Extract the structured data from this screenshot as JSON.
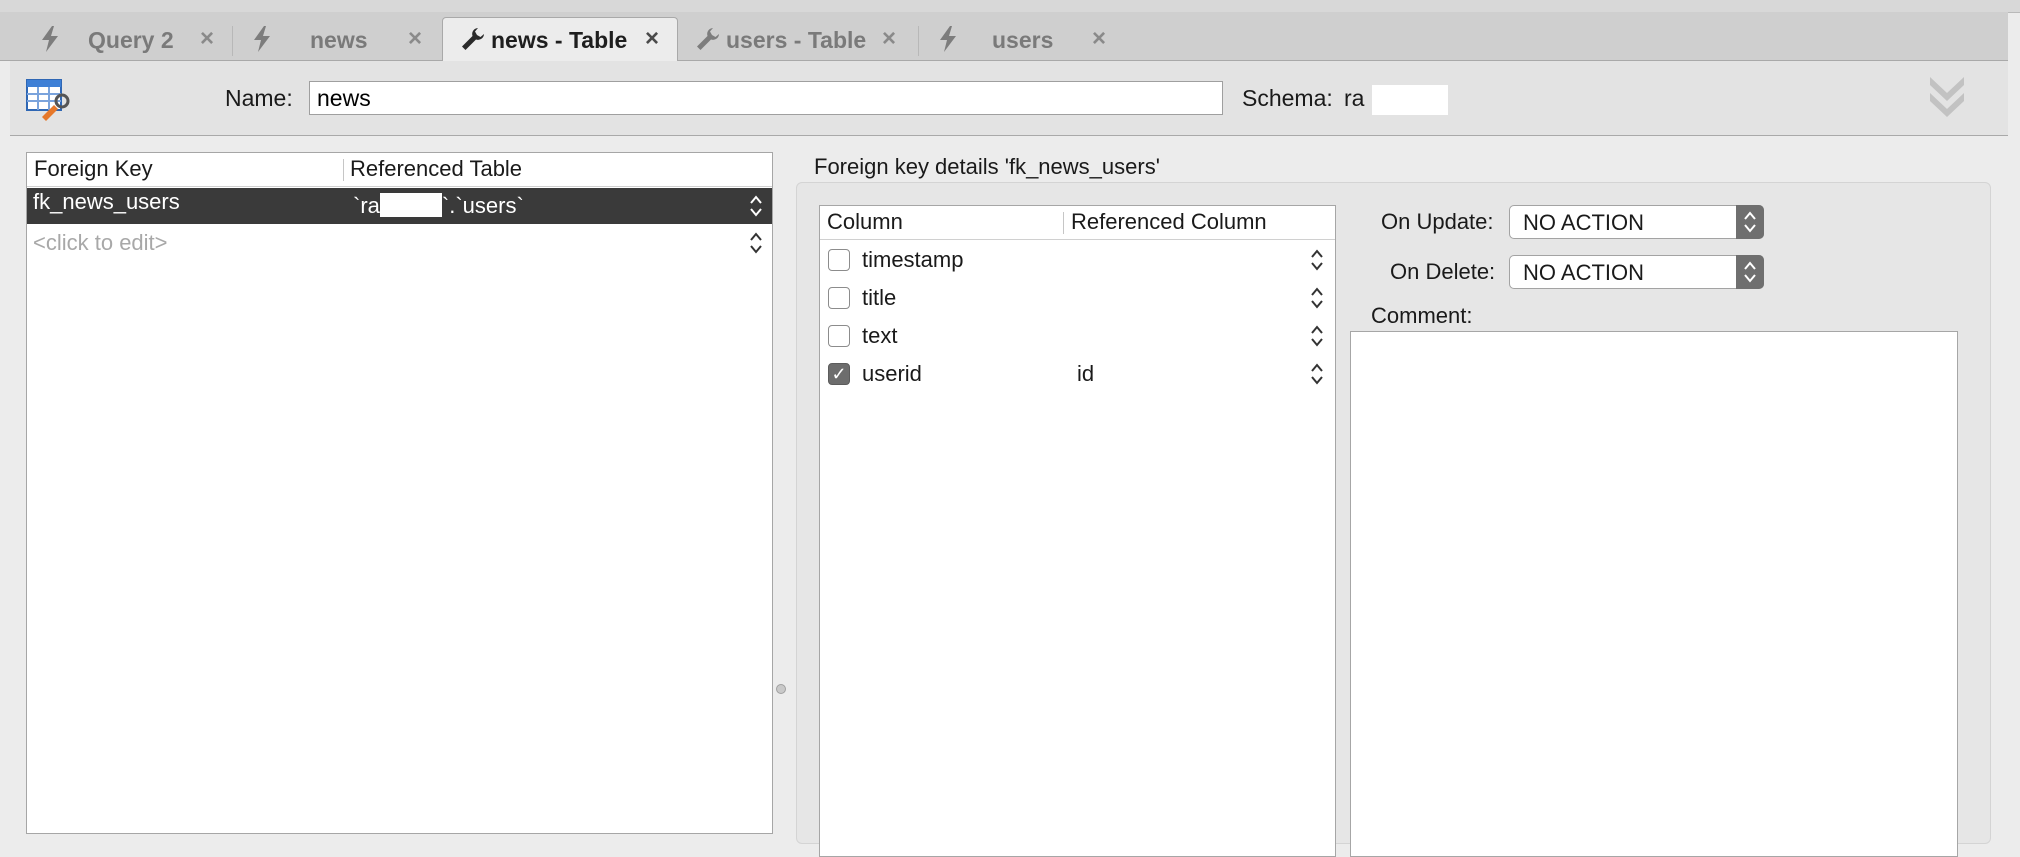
{
  "tabs": [
    {
      "label": "Query 2",
      "icon": "lightning-icon",
      "active": false
    },
    {
      "label": "news",
      "icon": "lightning-icon",
      "active": false
    },
    {
      "label": "news - Table",
      "icon": "wrench-icon",
      "active": true
    },
    {
      "label": "users - Table",
      "icon": "wrench-icon",
      "active": false
    },
    {
      "label": "users",
      "icon": "lightning-icon",
      "active": false
    }
  ],
  "header": {
    "name_label": "Name:",
    "name_value": "news",
    "schema_label": "Schema:",
    "schema_value": "ra"
  },
  "foreign_keys": {
    "columns": [
      "Foreign Key",
      "Referenced Table"
    ],
    "rows": [
      {
        "name": "fk_news_users",
        "ref_prefix": "`ra",
        "ref_suffix": "`.`users`"
      }
    ],
    "placeholder": "<click to edit>"
  },
  "details": {
    "title": "Foreign key details 'fk_news_users'",
    "columns": [
      "Column",
      "Referenced Column"
    ],
    "rows": [
      {
        "column": "timestamp",
        "checked": false,
        "ref": ""
      },
      {
        "column": "title",
        "checked": false,
        "ref": ""
      },
      {
        "column": "text",
        "checked": false,
        "ref": ""
      },
      {
        "column": "userid",
        "checked": true,
        "ref": "id"
      }
    ],
    "on_update_label": "On Update:",
    "on_update_value": "NO ACTION",
    "on_delete_label": "On Delete:",
    "on_delete_value": "NO ACTION",
    "comment_label": "Comment:",
    "comment_value": ""
  },
  "check_glyph": "✓"
}
